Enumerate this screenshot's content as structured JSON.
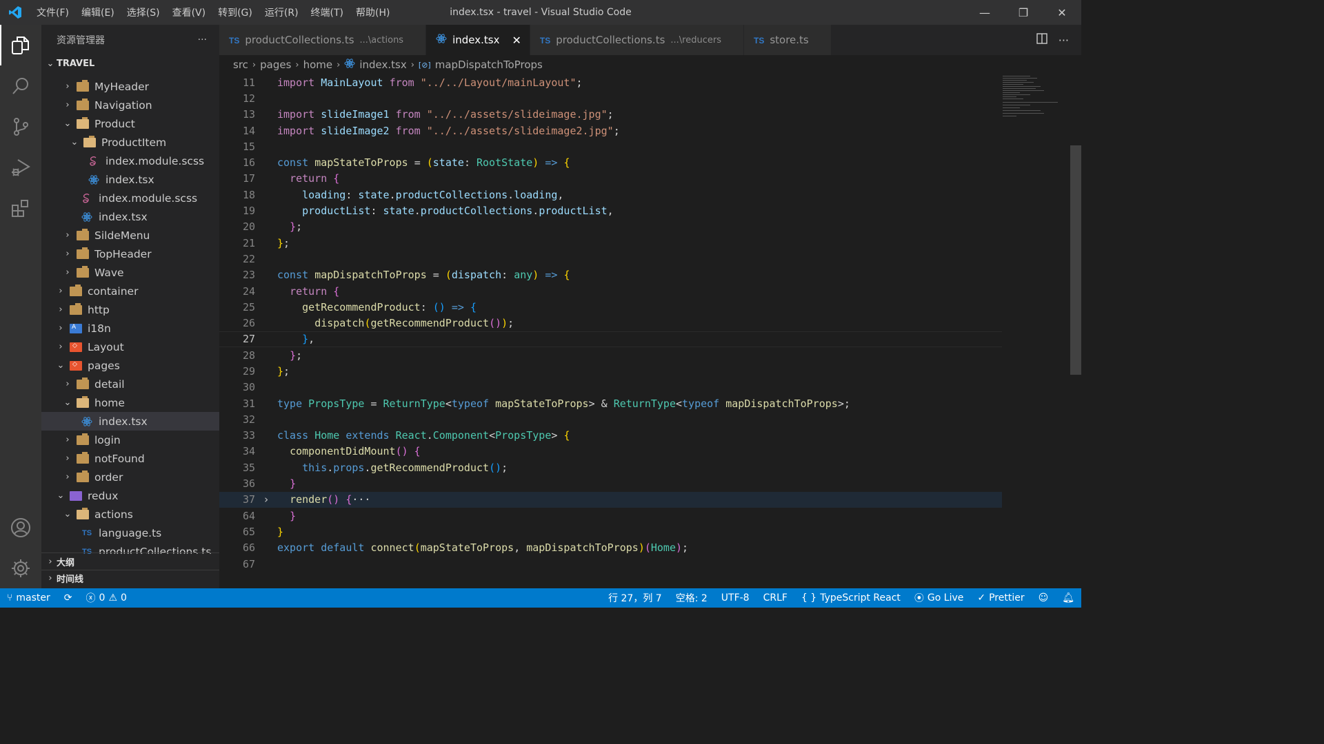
{
  "titlebar": {
    "menu": [
      "文件(F)",
      "编辑(E)",
      "选择(S)",
      "查看(V)",
      "转到(G)",
      "运行(R)",
      "终端(T)",
      "帮助(H)"
    ],
    "title": "index.tsx - travel - Visual Studio Code",
    "window_controls": {
      "minimize": "—",
      "restore": "❐",
      "close": "✕"
    }
  },
  "activitybar": {
    "items": [
      "explorer-icon",
      "search-icon",
      "source-control-icon",
      "run-debug-icon",
      "extensions-icon"
    ],
    "bottom": [
      "account-icon",
      "settings-gear-icon"
    ]
  },
  "sidebar": {
    "title": "资源管理器",
    "more": "···",
    "section": "TRAVEL",
    "tree": [
      {
        "label": "MyHeader",
        "type": "folder",
        "depth": 2,
        "expanded": false
      },
      {
        "label": "Navigation",
        "type": "folder",
        "depth": 2,
        "expanded": false
      },
      {
        "label": "Product",
        "type": "folder",
        "depth": 2,
        "expanded": true
      },
      {
        "label": "ProductItem",
        "type": "folder",
        "depth": 3,
        "expanded": true
      },
      {
        "label": "index.module.scss",
        "type": "scss",
        "depth": 4
      },
      {
        "label": "index.tsx",
        "type": "react",
        "depth": 4
      },
      {
        "label": "index.module.scss",
        "type": "scss",
        "depth": 3
      },
      {
        "label": "index.tsx",
        "type": "react",
        "depth": 3
      },
      {
        "label": "SildeMenu",
        "type": "folder",
        "depth": 2,
        "expanded": false
      },
      {
        "label": "TopHeader",
        "type": "folder",
        "depth": 2,
        "expanded": false
      },
      {
        "label": "Wave",
        "type": "folder",
        "depth": 2,
        "expanded": false
      },
      {
        "label": "container",
        "type": "folder",
        "depth": 1,
        "expanded": false
      },
      {
        "label": "http",
        "type": "folder",
        "depth": 1,
        "expanded": false
      },
      {
        "label": "i18n",
        "type": "i18n",
        "depth": 1,
        "expanded": false
      },
      {
        "label": "Layout",
        "type": "layout",
        "depth": 1,
        "expanded": false
      },
      {
        "label": "pages",
        "type": "layout",
        "depth": 1,
        "expanded": true
      },
      {
        "label": "detail",
        "type": "folder",
        "depth": 2,
        "expanded": false
      },
      {
        "label": "home",
        "type": "folder",
        "depth": 2,
        "expanded": true
      },
      {
        "label": "index.tsx",
        "type": "react",
        "depth": 3,
        "selected": true
      },
      {
        "label": "login",
        "type": "folder",
        "depth": 2,
        "expanded": false
      },
      {
        "label": "notFound",
        "type": "folder",
        "depth": 2,
        "expanded": false
      },
      {
        "label": "order",
        "type": "folder",
        "depth": 2,
        "expanded": false
      },
      {
        "label": "redux",
        "type": "redux",
        "depth": 1,
        "expanded": true
      },
      {
        "label": "actions",
        "type": "folder",
        "depth": 2,
        "expanded": true
      },
      {
        "label": "language.ts",
        "type": "ts",
        "depth": 3
      },
      {
        "label": "productCollections.ts",
        "type": "ts",
        "depth": 3
      }
    ],
    "outline": "大纲",
    "timeline": "时间线"
  },
  "tabs": [
    {
      "label": "productCollections.ts",
      "desc": "...\\actions",
      "icon": "TS",
      "active": false
    },
    {
      "label": "index.tsx",
      "desc": "",
      "icon": "react",
      "active": true,
      "close": "✕"
    },
    {
      "label": "productCollections.ts",
      "desc": "...\\reducers",
      "icon": "TS",
      "active": false
    },
    {
      "label": "store.ts",
      "desc": "",
      "icon": "TS",
      "active": false
    }
  ],
  "breadcrumb": [
    "src",
    "pages",
    "home",
    "index.tsx",
    "mapDispatchToProps"
  ],
  "code": [
    {
      "n": "11",
      "tokens": [
        [
          "k2",
          "import "
        ],
        [
          "v",
          "MainLayout "
        ],
        [
          "k2",
          "from "
        ],
        [
          "s",
          "\"../../Layout/mainLayout\""
        ],
        [
          "p",
          ";"
        ]
      ]
    },
    {
      "n": "12",
      "tokens": []
    },
    {
      "n": "13",
      "tokens": [
        [
          "k2",
          "import "
        ],
        [
          "v",
          "slideImage1 "
        ],
        [
          "k2",
          "from "
        ],
        [
          "s",
          "\"../../assets/slideimage.jpg\""
        ],
        [
          "p",
          ";"
        ]
      ]
    },
    {
      "n": "14",
      "tokens": [
        [
          "k2",
          "import "
        ],
        [
          "v",
          "slideImage2 "
        ],
        [
          "k2",
          "from "
        ],
        [
          "s",
          "\"../../assets/slideimage2.jpg\""
        ],
        [
          "p",
          ";"
        ]
      ]
    },
    {
      "n": "15",
      "tokens": []
    },
    {
      "n": "16",
      "tokens": [
        [
          "k",
          "const "
        ],
        [
          "f",
          "mapStateToProps "
        ],
        [
          "p",
          "= "
        ],
        [
          "b1",
          "("
        ],
        [
          "v",
          "state"
        ],
        [
          "p",
          ": "
        ],
        [
          "t",
          "RootState"
        ],
        [
          "b1",
          ")"
        ],
        [
          "k",
          " => "
        ],
        [
          "b1",
          "{"
        ]
      ]
    },
    {
      "n": "17",
      "tokens": [
        [
          "p",
          "  "
        ],
        [
          "k2",
          "return "
        ],
        [
          "b2",
          "{"
        ]
      ]
    },
    {
      "n": "18",
      "tokens": [
        [
          "p",
          "    "
        ],
        [
          "v",
          "loading"
        ],
        [
          "p",
          ": "
        ],
        [
          "v",
          "state"
        ],
        [
          "p",
          "."
        ],
        [
          "v",
          "productCollections"
        ],
        [
          "p",
          "."
        ],
        [
          "v",
          "loading"
        ],
        [
          "p",
          ","
        ]
      ]
    },
    {
      "n": "19",
      "tokens": [
        [
          "p",
          "    "
        ],
        [
          "v",
          "productList"
        ],
        [
          "p",
          ": "
        ],
        [
          "v",
          "state"
        ],
        [
          "p",
          "."
        ],
        [
          "v",
          "productCollections"
        ],
        [
          "p",
          "."
        ],
        [
          "v",
          "productList"
        ],
        [
          "p",
          ","
        ]
      ]
    },
    {
      "n": "20",
      "tokens": [
        [
          "p",
          "  "
        ],
        [
          "b2",
          "}"
        ],
        [
          "p",
          ";"
        ]
      ]
    },
    {
      "n": "21",
      "tokens": [
        [
          "b1",
          "}"
        ],
        [
          "p",
          ";"
        ]
      ]
    },
    {
      "n": "22",
      "tokens": []
    },
    {
      "n": "23",
      "tokens": [
        [
          "k",
          "const "
        ],
        [
          "f",
          "mapDispatchToProps "
        ],
        [
          "p",
          "= "
        ],
        [
          "b1",
          "("
        ],
        [
          "v",
          "dispatch"
        ],
        [
          "p",
          ": "
        ],
        [
          "t",
          "any"
        ],
        [
          "b1",
          ")"
        ],
        [
          "k",
          " => "
        ],
        [
          "b1",
          "{"
        ]
      ]
    },
    {
      "n": "24",
      "tokens": [
        [
          "p",
          "  "
        ],
        [
          "k2",
          "return "
        ],
        [
          "b2",
          "{"
        ]
      ]
    },
    {
      "n": "25",
      "tokens": [
        [
          "p",
          "    "
        ],
        [
          "f",
          "getRecommendProduct"
        ],
        [
          "p",
          ": "
        ],
        [
          "b3",
          "()"
        ],
        [
          "k",
          " => "
        ],
        [
          "b3",
          "{"
        ]
      ]
    },
    {
      "n": "26",
      "tokens": [
        [
          "p",
          "      "
        ],
        [
          "f",
          "dispatch"
        ],
        [
          "b1",
          "("
        ],
        [
          "f",
          "getRecommendProduct"
        ],
        [
          "b2",
          "()"
        ],
        [
          "b1",
          ")"
        ],
        [
          "p",
          ";"
        ]
      ]
    },
    {
      "n": "27",
      "tokens": [
        [
          "p",
          "    "
        ],
        [
          "b3",
          "}"
        ],
        [
          "p",
          ","
        ]
      ],
      "current": true
    },
    {
      "n": "28",
      "tokens": [
        [
          "p",
          "  "
        ],
        [
          "b2",
          "}"
        ],
        [
          "p",
          ";"
        ]
      ]
    },
    {
      "n": "29",
      "tokens": [
        [
          "b1",
          "}"
        ],
        [
          "p",
          ";"
        ]
      ]
    },
    {
      "n": "30",
      "tokens": []
    },
    {
      "n": "31",
      "tokens": [
        [
          "k",
          "type "
        ],
        [
          "t",
          "PropsType "
        ],
        [
          "p",
          "= "
        ],
        [
          "t",
          "ReturnType"
        ],
        [
          "p",
          "<"
        ],
        [
          "k",
          "typeof "
        ],
        [
          "f",
          "mapStateToProps"
        ],
        [
          "p",
          "> & "
        ],
        [
          "t",
          "ReturnType"
        ],
        [
          "p",
          "<"
        ],
        [
          "k",
          "typeof "
        ],
        [
          "f",
          "mapDispatchToProps"
        ],
        [
          "p",
          ">;"
        ]
      ]
    },
    {
      "n": "32",
      "tokens": []
    },
    {
      "n": "33",
      "tokens": [
        [
          "k",
          "class "
        ],
        [
          "t",
          "Home "
        ],
        [
          "k",
          "extends "
        ],
        [
          "t",
          "React"
        ],
        [
          "p",
          "."
        ],
        [
          "t",
          "Component"
        ],
        [
          "p",
          "<"
        ],
        [
          "t",
          "PropsType"
        ],
        [
          "p",
          "> "
        ],
        [
          "b1",
          "{"
        ]
      ]
    },
    {
      "n": "34",
      "tokens": [
        [
          "p",
          "  "
        ],
        [
          "f",
          "componentDidMount"
        ],
        [
          "b2",
          "() {"
        ]
      ]
    },
    {
      "n": "35",
      "tokens": [
        [
          "p",
          "    "
        ],
        [
          "k",
          "this"
        ],
        [
          "p",
          "."
        ],
        [
          "k",
          "props"
        ],
        [
          "p",
          "."
        ],
        [
          "f",
          "getRecommendProduct"
        ],
        [
          "b3",
          "()"
        ],
        [
          "p",
          ";"
        ]
      ]
    },
    {
      "n": "36",
      "tokens": [
        [
          "p",
          "  "
        ],
        [
          "b2",
          "}"
        ]
      ]
    },
    {
      "n": "37",
      "tokens": [
        [
          "p",
          "  "
        ],
        [
          "f",
          "render"
        ],
        [
          "b2",
          "() {"
        ],
        [
          "p",
          "···"
        ]
      ],
      "folded": true,
      "fold_icon": "›"
    },
    {
      "n": "64",
      "tokens": [
        [
          "p",
          "  "
        ],
        [
          "b2",
          "}"
        ]
      ]
    },
    {
      "n": "65",
      "tokens": [
        [
          "b1",
          "}"
        ]
      ]
    },
    {
      "n": "66",
      "tokens": [
        [
          "k",
          "export "
        ],
        [
          "k",
          "default "
        ],
        [
          "f",
          "connect"
        ],
        [
          "b1",
          "("
        ],
        [
          "f",
          "mapStateToProps"
        ],
        [
          "p",
          ", "
        ],
        [
          "f",
          "mapDispatchToProps"
        ],
        [
          "b1",
          ")"
        ],
        [
          "b2",
          "("
        ],
        [
          "t",
          "Home"
        ],
        [
          "b2",
          ")"
        ],
        [
          "p",
          ";"
        ]
      ]
    },
    {
      "n": "67",
      "tokens": []
    }
  ],
  "statusbar": {
    "branch": "master",
    "sync": "⟳",
    "errors": "0",
    "warnings": "0",
    "position": "行 27，列 7",
    "spaces": "空格: 2",
    "encoding": "UTF-8",
    "eol": "CRLF",
    "language": "TypeScript React",
    "golive": "Go Live",
    "prettier": "Prettier"
  }
}
